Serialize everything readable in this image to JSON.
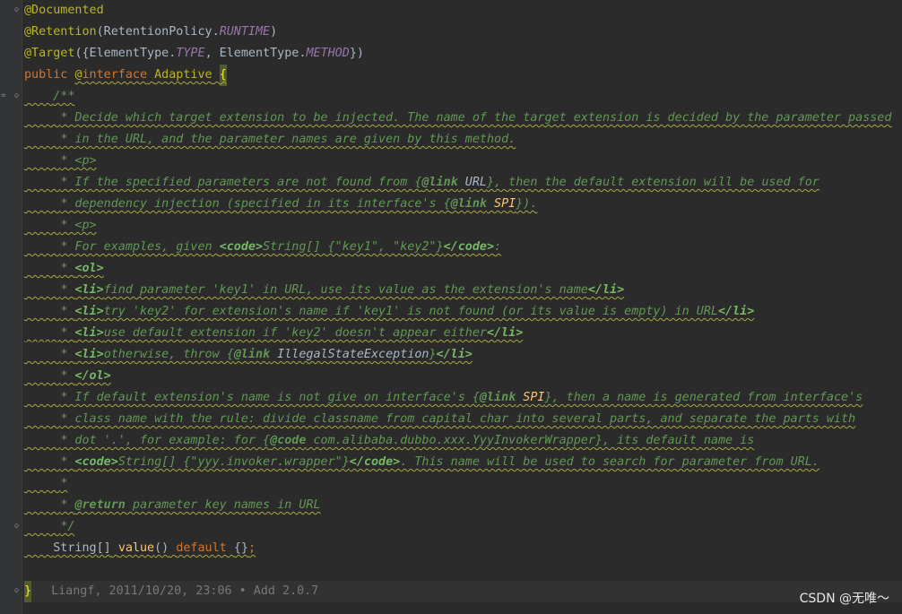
{
  "editor": {
    "line_annotations": {
      "documented": "@Documented",
      "retention_at": "@Retention",
      "retention_open": "(RetentionPolicy.",
      "retention_const": "RUNTIME",
      "retention_close": ")",
      "target_at": "@Target",
      "target_open": "({ElementType.",
      "target_const1": "TYPE",
      "target_sep": ", ElementType.",
      "target_const2": "METHOD",
      "target_close": "})"
    },
    "declaration": {
      "public": "public",
      "at": "@",
      "interface": "interface",
      "name": "Adaptive",
      "brace": "{"
    },
    "javadoc": {
      "open": "/**",
      "l1": "* Decide which target extension to be injected. The name of the target extension is decided by the parameter passed",
      "l2": "* in the URL, and the parameter names are given by this method.",
      "l3": "* <p>",
      "l4_a": "* If the specified parameters are not found from {",
      "l4_tag": "@link",
      "l4_ref": " URL",
      "l4_b": "}, then the default extension will be used for",
      "l5_a": "* dependency injection (specified in its interface's {",
      "l5_tag": "@link",
      "l5_ref": " SPI",
      "l5_b": "}).",
      "l6": "* <p>",
      "l7_a": "* For examples, given ",
      "l7_code_open": "<code>",
      "l7_b": "String[] {\"key1\", \"key2\"}",
      "l7_code_close": "</code>",
      "l7_c": ":",
      "l8_a": "* ",
      "l8_tag": "<ol>",
      "l9_a": "* ",
      "l9_li": "<li>",
      "l9_b": "find parameter 'key1' in URL, use its value as the extension's name",
      "l9_li_close": "</li>",
      "l10_a": "* ",
      "l10_li": "<li>",
      "l10_b": "try 'key2' for extension's name if 'key1' is not found (or its value is empty) in URL",
      "l10_li_close": "</li>",
      "l11_a": "* ",
      "l11_li": "<li>",
      "l11_b": "use default extension if 'key2' doesn't appear either",
      "l11_li_close": "</li>",
      "l12_a": "* ",
      "l12_li": "<li>",
      "l12_b": "otherwise, throw {",
      "l12_tag": "@link",
      "l12_ref": " IllegalStateException",
      "l12_c": "}",
      "l12_li_close": "</li>",
      "l13_a": "* ",
      "l13_tag": "</ol>",
      "l14_a": "* If default extension's name is not give on interface's {",
      "l14_tag": "@link",
      "l14_ref": " SPI",
      "l14_b": "}, then a name is generated from interface's",
      "l15": "* class name with the rule: divide classname from capital char into several parts, and separate the parts with",
      "l16_a": "* dot '.', for example: for {",
      "l16_tag": "@code",
      "l16_ref": " com.alibaba.dubbo.xxx.YyyInvokerWrapper",
      "l16_b": "}, its default name is",
      "l17_a": "* ",
      "l17_code_open": "<code>",
      "l17_b": "String[] {\"yyy.invoker.wrapper\"}",
      "l17_code_close": "</code>",
      "l17_c": ". This name will be used to search for parameter from URL.",
      "l18": "*",
      "l19_a": "* ",
      "l19_tag": "@return",
      "l19_b": " parameter key names in URL",
      "close": "*/"
    },
    "method": {
      "type": "String[]",
      "name": "value",
      "parens": "()",
      "default_kw": "default",
      "value": "{}",
      "semi": ";"
    },
    "closing_brace": "}",
    "blame": "Liangf, 2011/10/20, 23:06 • Add 2.0.7"
  },
  "watermark": "CSDN @无唯～"
}
